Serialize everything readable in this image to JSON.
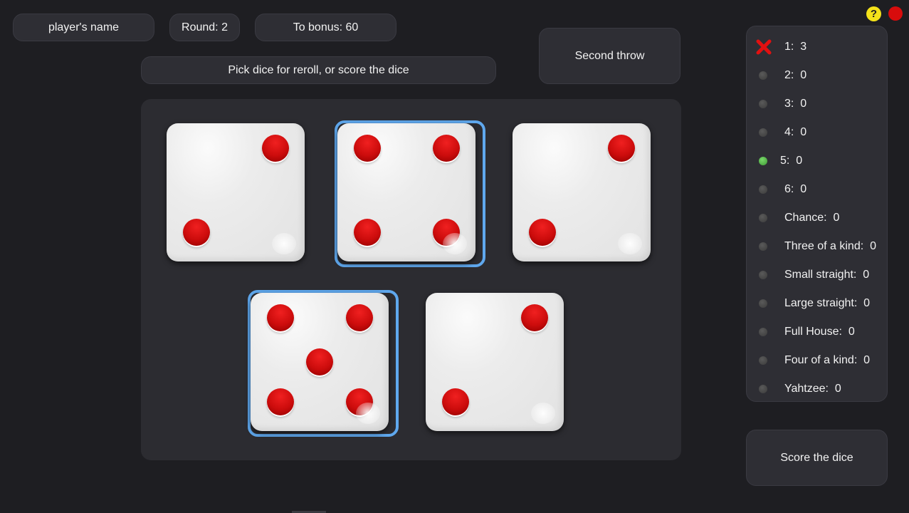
{
  "header": {
    "player_name": "player's name",
    "round": "Round:  2",
    "to_bonus": "To bonus: 60"
  },
  "instruction": "Pick dice for reroll, or score the dice",
  "throw_button": "Second throw",
  "score_button": "Score the dice",
  "colors": {
    "background": "#1e1e22",
    "panel": "#2e2e34",
    "held_border": "#5fa8ee",
    "pip": "#cc0c0c",
    "help": "#f4e21a",
    "close": "#d80c0c",
    "active_dot": "#4caf3f"
  },
  "dice": [
    {
      "value": 2,
      "held": false
    },
    {
      "value": 4,
      "held": true
    },
    {
      "value": 2,
      "held": false
    },
    {
      "value": 5,
      "held": true
    },
    {
      "value": 2,
      "held": false
    }
  ],
  "scores": [
    {
      "label": "1:  3",
      "marker": "x-mark"
    },
    {
      "label": "2:  0",
      "marker": "dot"
    },
    {
      "label": "3:  0",
      "marker": "dot"
    },
    {
      "label": "4:  0",
      "marker": "dot"
    },
    {
      "label": "5:  0",
      "marker": "dot-green"
    },
    {
      "label": "6:  0",
      "marker": "dot"
    },
    {
      "label": "Chance:  0",
      "marker": "dot"
    },
    {
      "label": "Three of a kind:  0",
      "marker": "dot"
    },
    {
      "label": "Small straight:  0",
      "marker": "dot"
    },
    {
      "label": "Large straight:  0",
      "marker": "dot"
    },
    {
      "label": "Full House:  0",
      "marker": "dot"
    },
    {
      "label": "Four of a kind:  0",
      "marker": "dot"
    },
    {
      "label": "Yahtzee:  0",
      "marker": "dot"
    }
  ],
  "icons": {
    "help": "?",
    "close": "close-icon"
  }
}
